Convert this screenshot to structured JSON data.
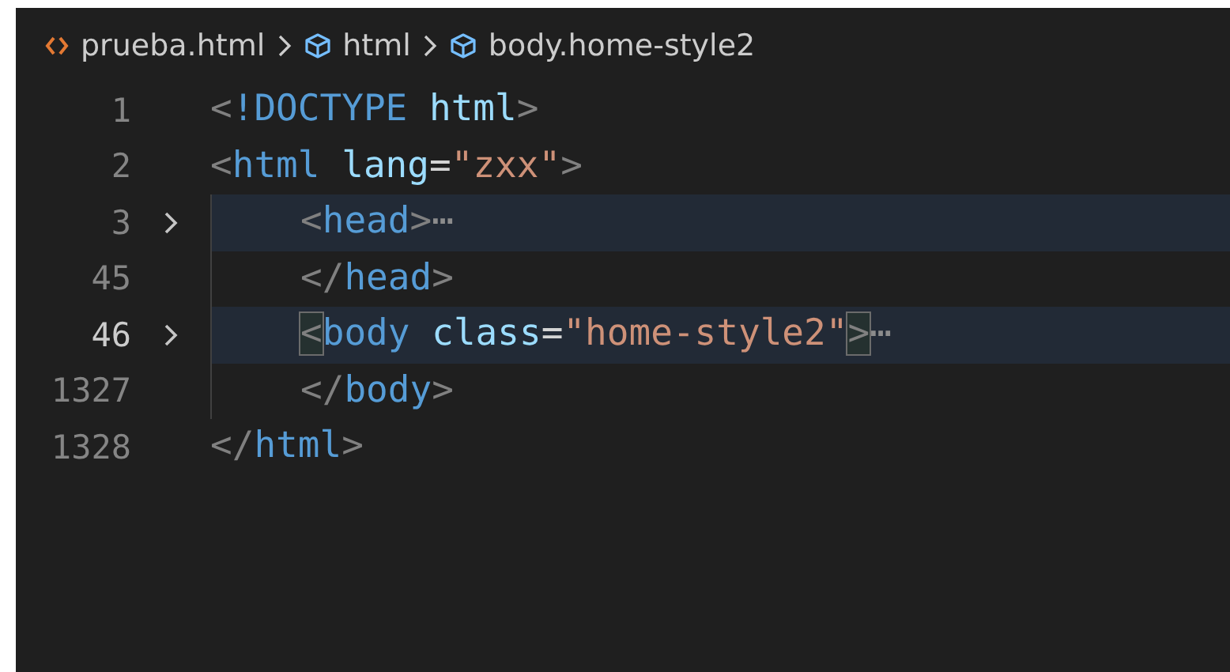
{
  "breadcrumbs": [
    {
      "label": "prueba.html",
      "kind": "file"
    },
    {
      "label": "html",
      "kind": "element"
    },
    {
      "label": "body.home-style2",
      "kind": "element"
    }
  ],
  "lines": [
    {
      "number": "1",
      "current": false,
      "folded": false,
      "tokens": [
        {
          "kind": "punct",
          "text": "<"
        },
        {
          "kind": "tag",
          "text": "!DOCTYPE"
        },
        {
          "kind": "attr",
          "text": " html"
        },
        {
          "kind": "punct",
          "text": ">"
        }
      ]
    },
    {
      "number": "2",
      "current": false,
      "folded": false,
      "tokens": [
        {
          "kind": "punct",
          "text": "<"
        },
        {
          "kind": "tag",
          "text": "html"
        },
        {
          "kind": "attr",
          "text": " lang"
        },
        {
          "kind": "text",
          "text": "="
        },
        {
          "kind": "string",
          "text": "\"zxx\""
        },
        {
          "kind": "punct",
          "text": ">"
        }
      ],
      "children": [
        {
          "number": "3",
          "current": false,
          "folded": true,
          "tokens": [
            {
              "kind": "punct",
              "text": "<"
            },
            {
              "kind": "tag",
              "text": "head"
            },
            {
              "kind": "punct",
              "text": ">"
            },
            {
              "kind": "ellipsis",
              "text": "⋯"
            }
          ]
        },
        {
          "number": "45",
          "current": false,
          "folded": false,
          "tokens": [
            {
              "kind": "punct",
              "text": "</"
            },
            {
              "kind": "tag",
              "text": "head"
            },
            {
              "kind": "punct",
              "text": ">"
            }
          ]
        },
        {
          "number": "46",
          "current": true,
          "folded": true,
          "tokens": [
            {
              "kind": "punct",
              "text": "<",
              "matched": true
            },
            {
              "kind": "tag",
              "text": "body"
            },
            {
              "kind": "attr",
              "text": " class"
            },
            {
              "kind": "text",
              "text": "="
            },
            {
              "kind": "string",
              "text": "\"home-style2\""
            },
            {
              "kind": "punct",
              "text": ">",
              "matched": true
            },
            {
              "kind": "ellipsis",
              "text": "⋯"
            }
          ]
        },
        {
          "number": "1327",
          "current": false,
          "folded": false,
          "tokens": [
            {
              "kind": "punct",
              "text": "</"
            },
            {
              "kind": "tag",
              "text": "body"
            },
            {
              "kind": "punct",
              "text": ">"
            }
          ]
        }
      ]
    },
    {
      "number": "1328",
      "current": false,
      "folded": false,
      "tokens": [
        {
          "kind": "punct",
          "text": "</"
        },
        {
          "kind": "tag",
          "text": "html"
        },
        {
          "kind": "punct",
          "text": ">"
        }
      ]
    }
  ]
}
